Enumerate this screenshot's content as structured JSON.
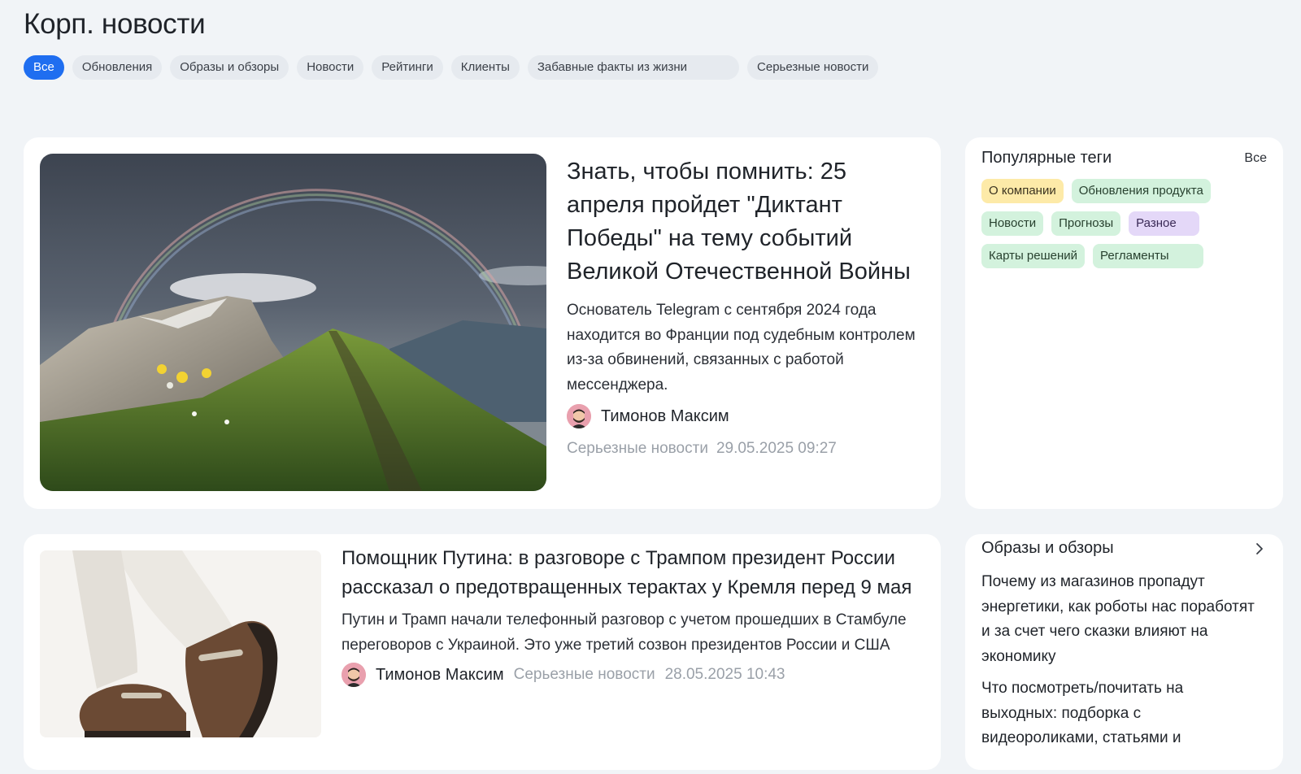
{
  "header": {
    "title": "Корп. новости"
  },
  "filters": [
    "Все",
    "Обновления",
    "Образы и обзоры",
    "Новости",
    "Рейтинги",
    "Клиенты",
    "Забавные факты из жизни",
    "Серьезные новости"
  ],
  "filters_active": "Все",
  "articles": [
    {
      "title": "Знать, чтобы помнить: 25 апреля пройдет \"Диктант Победы\" на тему событий Великой Отечественной Войны",
      "lead": "Основатель Telegram с сентября 2024 года находится во Франции под судебным контролем из-за обвинений, связанных с работой мессенджера.",
      "author": "Тимонов Максим",
      "category": "Серьезные новости",
      "date": "29.05.2025 09:27"
    },
    {
      "title": "Помощник Путина: в разговоре с Трампом президент России рассказал о предотвращенных терактах у Кремля перед 9 мая",
      "lead": "Путин и Трамп начали телефонный разговор с учетом прошедших в Стамбуле переговоров с Украиной. Это уже третий созвон президентов России и США",
      "author": "Тимонов Максим",
      "category": "Серьезные новости",
      "date": "28.05.2025 10:43"
    }
  ],
  "popular_tags": {
    "title": "Популярные теги",
    "all_link": "Все",
    "tags": [
      {
        "label": "О компании",
        "color": "#fdeaa8"
      },
      {
        "label": "Обновления продукта",
        "color": "#d3f2dd"
      },
      {
        "label": "Новости",
        "color": "#d3f2dd"
      },
      {
        "label": "Прогнозы",
        "color": "#d3f2dd"
      },
      {
        "label": "Разное",
        "color": "#e4d8f8"
      },
      {
        "label": "Карты решений",
        "color": "#d3f2dd"
      },
      {
        "label": "Регламенты",
        "color": "#d3f2dd"
      }
    ]
  },
  "reviews": {
    "title": "Образы и обзоры",
    "items": [
      "Почему из магазинов пропадут энергетики, как роботы нас поработят и за счет чего сказки влияют на экономику",
      "Что посмотреть/почитать на выходных: подборка с видеороликами, статьями и"
    ]
  },
  "colors": {
    "accent": "#1f6ef0",
    "background": "#f1f4f7",
    "muted_text": "#9aa0a8"
  },
  "icons": [
    "mountain-rainbow-photo",
    "loafers-photo",
    "avatar",
    "chevron-right-icon"
  ]
}
